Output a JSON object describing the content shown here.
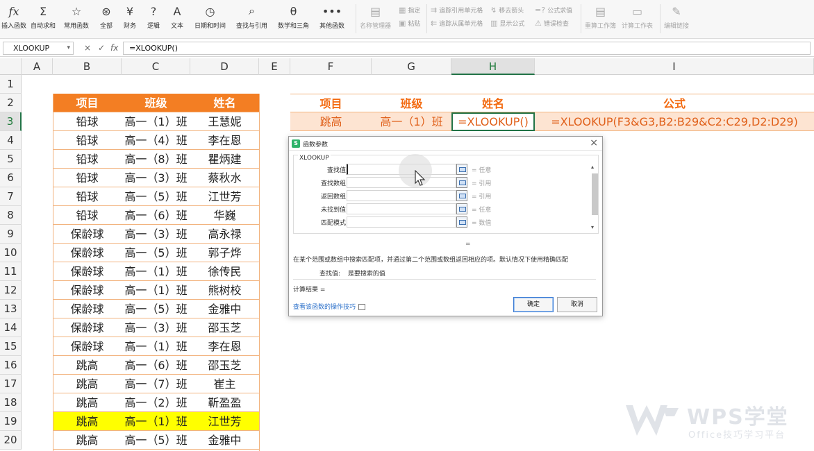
{
  "ribbon": {
    "buttons": [
      {
        "label": "插入函数",
        "icon": "fx-icon",
        "glyph": "fx"
      },
      {
        "label": "自动求和",
        "icon": "sum-icon",
        "glyph": "Σ"
      },
      {
        "label": "常用函数",
        "icon": "star-icon",
        "glyph": "☆"
      },
      {
        "label": "全部",
        "icon": "all-functions-icon",
        "glyph": "⊛"
      },
      {
        "label": "财务",
        "icon": "finance-icon",
        "glyph": "¥"
      },
      {
        "label": "逻辑",
        "icon": "logic-icon",
        "glyph": "?"
      },
      {
        "label": "文本",
        "icon": "text-icon",
        "glyph": "A"
      },
      {
        "label": "日期和时间",
        "icon": "clock-icon",
        "glyph": "◷"
      },
      {
        "label": "查找与引用",
        "icon": "lookup-icon",
        "glyph": "⌕"
      },
      {
        "label": "数学和三角",
        "icon": "math-icon",
        "glyph": "θ"
      },
      {
        "label": "其他函数",
        "icon": "more-icon",
        "glyph": "•••"
      }
    ],
    "secondary": {
      "name_manager": "名称管理器",
      "specify": "指定",
      "paste": "粘贴",
      "trace_precedents": "追踪引用单元格",
      "trace_dependents": "追踪从属单元格",
      "remove_arrows": "移去箭头",
      "show_formulas": "显示公式",
      "evaluate": "公式求值",
      "error_check": "错误检查",
      "recalc_workbook": "重算工作簿",
      "calc_sheet": "计算工作表",
      "edit_links": "编辑链接"
    }
  },
  "formula_bar": {
    "name_box": "XLOOKUP",
    "cancel": "×",
    "confirm": "✓",
    "fx": "fx",
    "formula": "=XLOOKUP()"
  },
  "columns": [
    "A",
    "B",
    "C",
    "D",
    "E",
    "F",
    "G",
    "H",
    "I"
  ],
  "rows": [
    "1",
    "2",
    "3",
    "4",
    "5",
    "6",
    "7",
    "8",
    "9",
    "10",
    "11",
    "12",
    "13",
    "14",
    "15",
    "16",
    "17",
    "18",
    "19",
    "20"
  ],
  "left_table": {
    "headers": [
      "项目",
      "班级",
      "姓名"
    ],
    "rows": [
      [
        "铅球",
        "高一（1）班",
        "王慧妮"
      ],
      [
        "铅球",
        "高一（4）班",
        "李在恩"
      ],
      [
        "铅球",
        "高一（8）班",
        "瞿炳建"
      ],
      [
        "铅球",
        "高一（3）班",
        "蔡秋水"
      ],
      [
        "铅球",
        "高一（5）班",
        "江世芳"
      ],
      [
        "铅球",
        "高一（6）班",
        "华巍"
      ],
      [
        "保龄球",
        "高一（3）班",
        "高永禄"
      ],
      [
        "保龄球",
        "高一（5）班",
        "郭子烨"
      ],
      [
        "保龄球",
        "高一（1）班",
        "徐传民"
      ],
      [
        "保龄球",
        "高一（1）班",
        "熊树校"
      ],
      [
        "保龄球",
        "高一（5）班",
        "金雅中"
      ],
      [
        "保龄球",
        "高一（3）班",
        "邵玉芝"
      ],
      [
        "保龄球",
        "高一（1）班",
        "李在恩"
      ],
      [
        "跳高",
        "高一（6）班",
        "邵玉芝"
      ],
      [
        "跳高",
        "高一（7）班",
        "崔主"
      ],
      [
        "跳高",
        "高一（2）班",
        "靳盈盈"
      ],
      [
        "跳高",
        "高一（1）班",
        "江世芳"
      ],
      [
        "跳高",
        "高一（5）班",
        "金雅中"
      ]
    ],
    "highlight_row_index": 16
  },
  "right_table": {
    "headers": [
      "项目",
      "班级",
      "姓名",
      "公式"
    ],
    "row": [
      "跳高",
      "高一（1）班",
      "=XLOOKUP()",
      "=XLOOKUP(F3&G3,B2:B29&C2:C29,D2:D29)"
    ]
  },
  "dialog": {
    "title": "函数参数",
    "function_name": "XLOOKUP",
    "args": [
      {
        "label": "查找值",
        "value": "",
        "hint": "= 任意"
      },
      {
        "label": "查找数组",
        "value": "",
        "hint": "= 引用"
      },
      {
        "label": "返回数组",
        "value": "",
        "hint": "= 引用"
      },
      {
        "label": "未找到值",
        "value": "",
        "hint": "= 任意"
      },
      {
        "label": "匹配模式",
        "value": "",
        "hint": "= 数值"
      }
    ],
    "equals": "=",
    "description": "在某个范围或数组中搜索匹配项，并通过第二个范围或数组返回相应的项。默认情况下使用精确匹配",
    "param_name": "查找值:",
    "param_desc": "是要搜索的值",
    "result_label": "计算结果 =",
    "help_link": "查看该函数的操作技巧",
    "ok": "确定",
    "cancel": "取消"
  },
  "watermark": {
    "title": "WPS学堂",
    "subtitle": "Office技巧学习平台"
  }
}
